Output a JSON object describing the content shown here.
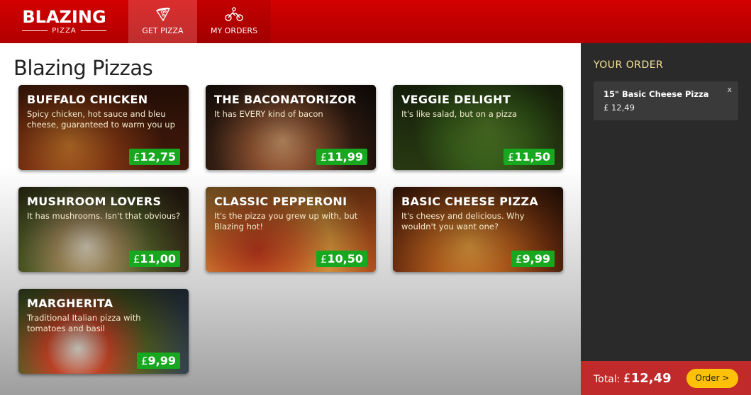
{
  "brand": {
    "name": "BLAZING",
    "sub": "PIZZA"
  },
  "nav": {
    "get_pizza": {
      "label": "GET PIZZA",
      "icon": "pizza-slice-icon"
    },
    "my_orders": {
      "label": "MY ORDERS",
      "icon": "delivery-bike-icon"
    }
  },
  "page": {
    "title": "Blazing Pizzas"
  },
  "currency": "£",
  "specials": [
    {
      "name": "BUFFALO CHICKEN",
      "description": "Spicy chicken, hot sauce and bleu cheese, guaranteed to warm you up",
      "price": "12,75"
    },
    {
      "name": "THE BACONATORIZOR",
      "description": "It has EVERY kind of bacon",
      "price": "11,99"
    },
    {
      "name": "VEGGIE DELIGHT",
      "description": "It's like salad, but on a pizza",
      "price": "11,50"
    },
    {
      "name": "MUSHROOM LOVERS",
      "description": "It has mushrooms. Isn't that obvious?",
      "price": "11,00"
    },
    {
      "name": "CLASSIC PEPPERONI",
      "description": "It's the pizza you grew up with, but Blazing hot!",
      "price": "10,50"
    },
    {
      "name": "BASIC CHEESE PIZZA",
      "description": "It's cheesy and delicious. Why wouldn't you want one?",
      "price": "9,99"
    },
    {
      "name": "MARGHERITA",
      "description": "Traditional Italian pizza with tomatoes and basil",
      "price": "9,99"
    }
  ],
  "order": {
    "title": "YOUR ORDER",
    "items": [
      {
        "name": "15\" Basic Cheese Pizza",
        "price": "£ 12,49",
        "remove": "x"
      }
    ],
    "total_label": "Total:",
    "total_amount": "12,49",
    "order_button": "Order >"
  },
  "colors": {
    "header": "#c40000",
    "price_badge": "#17a81f",
    "sidebar": "#2a2a2a",
    "footer": "#c12a2a",
    "order_button": "#ffc107",
    "order_title": "#f7e39b"
  }
}
